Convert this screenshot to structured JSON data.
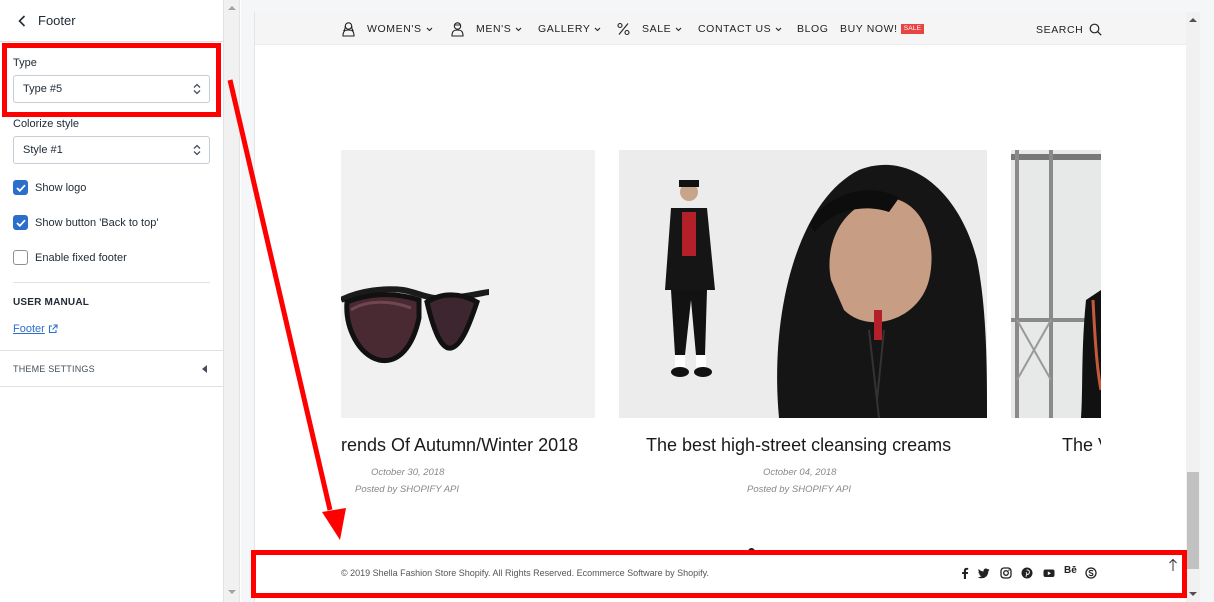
{
  "panel": {
    "title": "Footer",
    "type_label": "Type",
    "type_value": "Type #5",
    "colorize_label": "Colorize style",
    "colorize_value": "Style #1",
    "checkboxes": [
      {
        "label": "Show logo",
        "checked": true
      },
      {
        "label": "Show button 'Back to top'",
        "checked": true
      },
      {
        "label": "Enable fixed footer",
        "checked": false
      }
    ],
    "manual_title": "USER MANUAL",
    "manual_link": "Footer",
    "theme_settings": "THEME SETTINGS"
  },
  "nav": {
    "items": [
      "WOMEN'S",
      "MEN'S",
      "GALLERY",
      "SALE",
      "CONTACT US",
      "BLOG",
      "BUY NOW!"
    ],
    "sale_badge": "SALE",
    "search": "SEARCH"
  },
  "posts": [
    {
      "title": "rends Of Autumn/Winter 2018",
      "date": "October 30, 2018",
      "author": "Posted by SHOPIFY API"
    },
    {
      "title": "The best high-street cleansing creams",
      "date": "October 04, 2018",
      "author": "Posted by SHOPIFY API"
    },
    {
      "title": "The V"
    }
  ],
  "footer": {
    "copyright": "© 2019 Shella Fashion Store Shopify. All Rights Reserved. Ecommerce Software by Shopify.",
    "social": [
      "facebook-icon",
      "twitter-icon",
      "instagram-icon",
      "pinterest-icon",
      "youtube-icon",
      "behance-icon",
      "skype-icon"
    ]
  },
  "colors": {
    "accent": "#2c6ecb",
    "annotation": "#ff0000",
    "sale": "#e94444"
  }
}
